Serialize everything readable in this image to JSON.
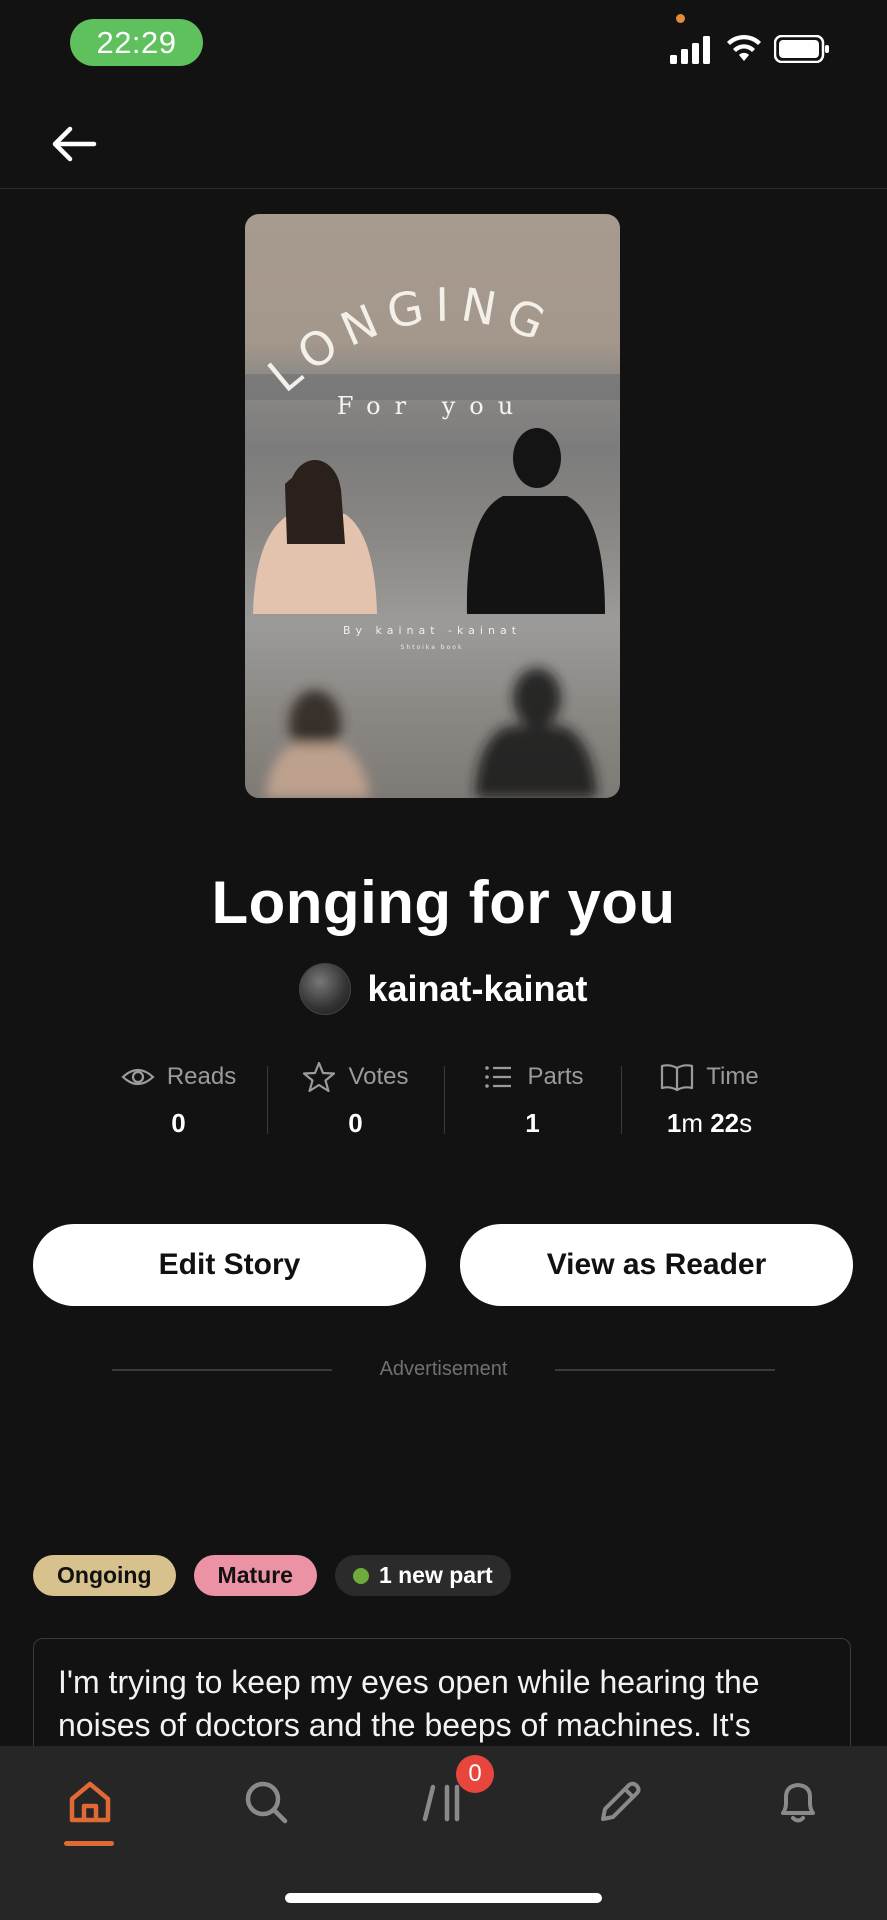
{
  "status_bar": {
    "time": "22:29"
  },
  "story": {
    "title": "Longing for you",
    "author": "kainat-kainat",
    "cover": {
      "title_text": "LONGING",
      "subtitle_text": "For you",
      "byline": "By kainat -kainat",
      "small_text": "Shtoika book"
    }
  },
  "stats": [
    {
      "label": "Reads",
      "value": "0",
      "icon": "eye-icon"
    },
    {
      "label": "Votes",
      "value": "0",
      "icon": "star-icon"
    },
    {
      "label": "Parts",
      "value": "1",
      "icon": "list-icon"
    },
    {
      "label": "Time",
      "value_parts": [
        "1",
        "m ",
        "22",
        "s"
      ],
      "icon": "book-icon"
    }
  ],
  "buttons": {
    "edit": "Edit Story",
    "view": "View as Reader"
  },
  "ad_label": "Advertisement",
  "tags": {
    "ongoing": "Ongoing",
    "mature": "Mature",
    "new_part": "1 new part"
  },
  "description": "I'm trying to keep my eyes open  while hearing the noises of doctors and the beeps of machines.  It's",
  "nav": {
    "items": [
      "home-icon",
      "search-icon",
      "library-icon",
      "write-icon",
      "notifications-icon"
    ],
    "library_badge": "0"
  },
  "colors": {
    "accent": "#e06a35",
    "background": "#121212",
    "time_pill": "#5ec15e",
    "badge": "#e8453c"
  }
}
